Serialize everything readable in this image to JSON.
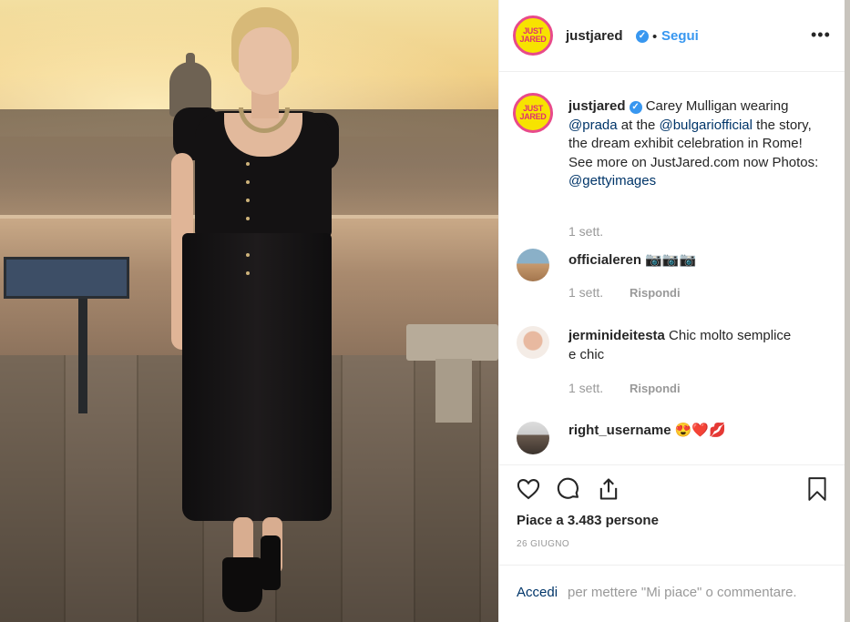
{
  "header": {
    "avatar_text": "JUST JARED",
    "username": "justjared",
    "separator": "•",
    "follow_label": "Segui",
    "more_label": "•••"
  },
  "caption": {
    "username": "justjared",
    "text_1": " Carey Mulligan wearing ",
    "mention_1": "@prada",
    "text_2": " at the ",
    "mention_2": "@bulgariofficial",
    "text_3": " the story, the dream exhibit celebration in Rome! See more on JustJared.com now Photos: ",
    "mention_3": "@gettyimages",
    "time": "1 sett."
  },
  "comments": [
    {
      "username": "officialeren",
      "text": " 📷📷📷",
      "time": "1 sett.",
      "reply": "Rispondi"
    },
    {
      "username": "jerminideitesta",
      "text": " Chic molto semplice e chic",
      "time": "1 sett.",
      "reply": "Rispondi"
    },
    {
      "username": "right_username",
      "text": " 😍❤️💋"
    }
  ],
  "actions": {
    "likes": "Piace a 3.483 persone",
    "date": "26 GIUGNO",
    "icons": [
      "heart-icon",
      "comment-icon",
      "share-icon",
      "bookmark-icon"
    ]
  },
  "footer": {
    "login": "Accedi",
    "rest": "per mettere \"Mi piace\" o commentare."
  },
  "colors": {
    "link": "#3897f0",
    "mention": "#003569",
    "muted": "#999999",
    "text": "#262626"
  }
}
